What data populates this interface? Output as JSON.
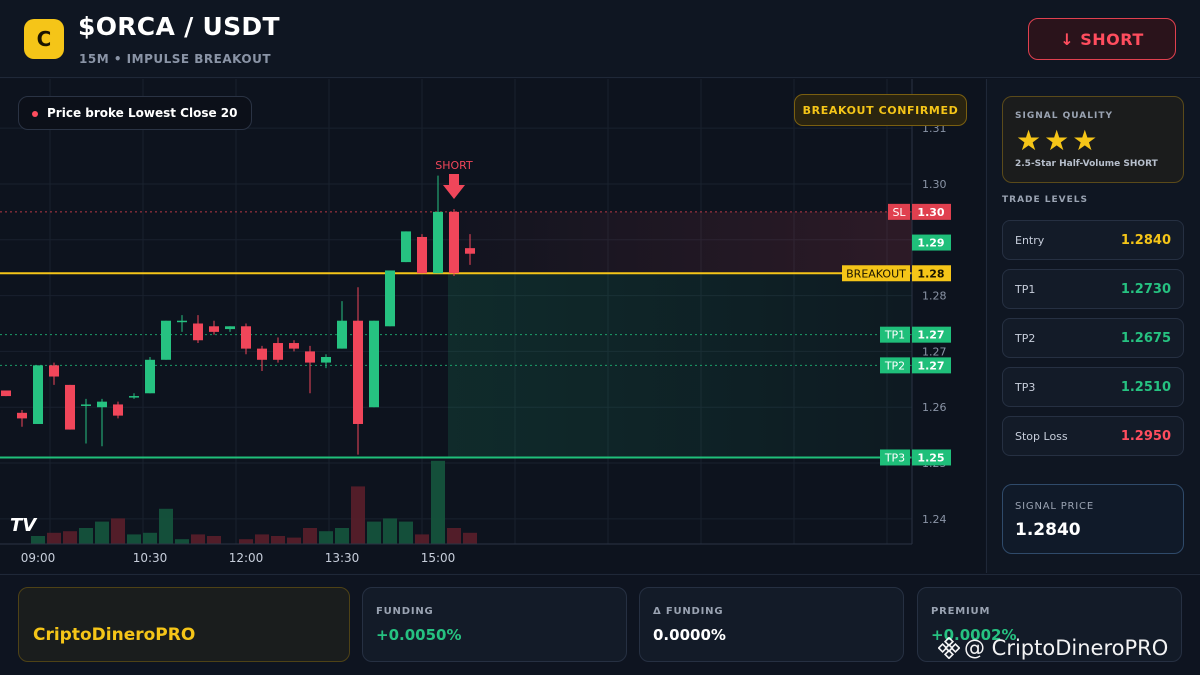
{
  "header": {
    "logo_letter": "C",
    "pair": "$ORCA / USDT",
    "subtitle": "15M • IMPULSE BREAKOUT",
    "short_button": "↓ SHORT"
  },
  "chart": {
    "badge_lowest": "Price broke Lowest Close 20",
    "badge_breakout": "BREAKOUT CONFIRMED",
    "short_marker": "SHORT",
    "tv_logo": "TV",
    "colors": {
      "up": "#26c281",
      "down": "#f0465a",
      "breakout": "#f5c518",
      "sl": "#e0404f",
      "tp": "#1fbf7a"
    }
  },
  "chart_data": {
    "type": "candlestick",
    "price_axis_ticks": [
      "1.31",
      "1.30",
      "1.29",
      "1.28",
      "1.27",
      "1.26",
      "1.25",
      "1.24"
    ],
    "ylim": [
      1.2355,
      1.3188
    ],
    "time_labels": [
      "09:00",
      "10:30",
      "12:00",
      "13:30",
      "15:00"
    ],
    "time_label_index": [
      1,
      8,
      14,
      20,
      26
    ],
    "candles": [
      {
        "o": 1.263,
        "h": 1.263,
        "l": 1.262,
        "c": 1.262
      },
      {
        "o": 1.259,
        "h": 1.2595,
        "l": 1.2565,
        "c": 1.258
      },
      {
        "o": 1.257,
        "h": 1.2675,
        "l": 1.257,
        "c": 1.2675
      },
      {
        "o": 1.2675,
        "h": 1.268,
        "l": 1.264,
        "c": 1.2655
      },
      {
        "o": 1.264,
        "h": 1.264,
        "l": 1.256,
        "c": 1.256
      },
      {
        "o": 1.2605,
        "h": 1.2615,
        "l": 1.2535,
        "c": 1.2605
      },
      {
        "o": 1.26,
        "h": 1.2615,
        "l": 1.253,
        "c": 1.261
      },
      {
        "o": 1.2605,
        "h": 1.261,
        "l": 1.258,
        "c": 1.2585
      },
      {
        "o": 1.262,
        "h": 1.2625,
        "l": 1.2615,
        "c": 1.262
      },
      {
        "o": 1.2625,
        "h": 1.269,
        "l": 1.2625,
        "c": 1.2685
      },
      {
        "o": 1.2685,
        "h": 1.2755,
        "l": 1.2685,
        "c": 1.2755
      },
      {
        "o": 1.2755,
        "h": 1.2765,
        "l": 1.2735,
        "c": 1.2755
      },
      {
        "o": 1.275,
        "h": 1.2765,
        "l": 1.2715,
        "c": 1.272
      },
      {
        "o": 1.2745,
        "h": 1.2755,
        "l": 1.273,
        "c": 1.2735
      },
      {
        "o": 1.274,
        "h": 1.2745,
        "l": 1.2735,
        "c": 1.2745
      },
      {
        "o": 1.2745,
        "h": 1.275,
        "l": 1.2695,
        "c": 1.2705
      },
      {
        "o": 1.2705,
        "h": 1.271,
        "l": 1.2665,
        "c": 1.2685
      },
      {
        "o": 1.2715,
        "h": 1.2725,
        "l": 1.268,
        "c": 1.2685
      },
      {
        "o": 1.2715,
        "h": 1.272,
        "l": 1.27,
        "c": 1.2705
      },
      {
        "o": 1.27,
        "h": 1.271,
        "l": 1.2625,
        "c": 1.268
      },
      {
        "o": 1.268,
        "h": 1.2695,
        "l": 1.267,
        "c": 1.269
      },
      {
        "o": 1.2705,
        "h": 1.279,
        "l": 1.2705,
        "c": 1.2755
      },
      {
        "o": 1.2755,
        "h": 1.2815,
        "l": 1.2515,
        "c": 1.257
      },
      {
        "o": 1.26,
        "h": 1.2755,
        "l": 1.26,
        "c": 1.2755
      },
      {
        "o": 1.2745,
        "h": 1.2845,
        "l": 1.2745,
        "c": 1.2845
      },
      {
        "o": 1.286,
        "h": 1.2915,
        "l": 1.286,
        "c": 1.2915
      },
      {
        "o": 1.2905,
        "h": 1.291,
        "l": 1.284,
        "c": 1.284
      },
      {
        "o": 1.284,
        "h": 1.3015,
        "l": 1.284,
        "c": 1.295
      },
      {
        "o": 1.295,
        "h": 1.2955,
        "l": 1.2835,
        "c": 1.284
      },
      {
        "o": 1.2885,
        "h": 1.291,
        "l": 1.2855,
        "c": 1.2875
      }
    ],
    "volume": [
      0,
      0,
      5,
      7,
      8,
      10,
      14,
      16,
      6,
      7,
      22,
      3,
      6,
      5,
      0,
      3,
      6,
      5,
      4,
      10,
      8,
      10,
      36,
      14,
      16,
      14,
      6,
      52,
      10,
      7
    ],
    "levels": {
      "sl": {
        "label": "SL",
        "value": "1.30",
        "price": 1.295
      },
      "entry_tag": {
        "value": "1.29",
        "price": 1.2895
      },
      "breakout": {
        "label": "BREAKOUT",
        "value": "1.28",
        "price": 1.284
      },
      "tp1": {
        "label": "TP1",
        "value": "1.27",
        "price": 1.273
      },
      "tp2": {
        "label": "TP2",
        "value": "1.27",
        "price": 1.2675
      },
      "tp3": {
        "label": "TP3",
        "value": "1.25",
        "price": 1.251
      }
    }
  },
  "sidebar": {
    "quality_label": "SIGNAL QUALITY",
    "stars": "★★★",
    "quality_desc": "2.5-Star Half-Volume SHORT",
    "trade_levels_label": "TRADE LEVELS",
    "levels": [
      {
        "key": "Entry",
        "value": "1.2840",
        "color": "#f5c518"
      },
      {
        "key": "TP1",
        "value": "1.2730",
        "color": "#26c281"
      },
      {
        "key": "TP2",
        "value": "1.2675",
        "color": "#26c281"
      },
      {
        "key": "TP3",
        "value": "1.2510",
        "color": "#26c281"
      },
      {
        "key": "Stop Loss",
        "value": "1.2950",
        "color": "#ff4d5e"
      }
    ],
    "signal_price_label": "SIGNAL PRICE",
    "signal_price": "1.2840"
  },
  "footer": {
    "brand": "CriptoDineroPRO",
    "funding_label": "FUNDING",
    "funding_value": "+0.0050%",
    "delta_funding_label": "Δ FUNDING",
    "delta_funding_value": "0.0000%",
    "premium_label": "PREMIUM",
    "premium_value": "+0.0002%",
    "watermark": "@ CriptoDineroPRO"
  }
}
